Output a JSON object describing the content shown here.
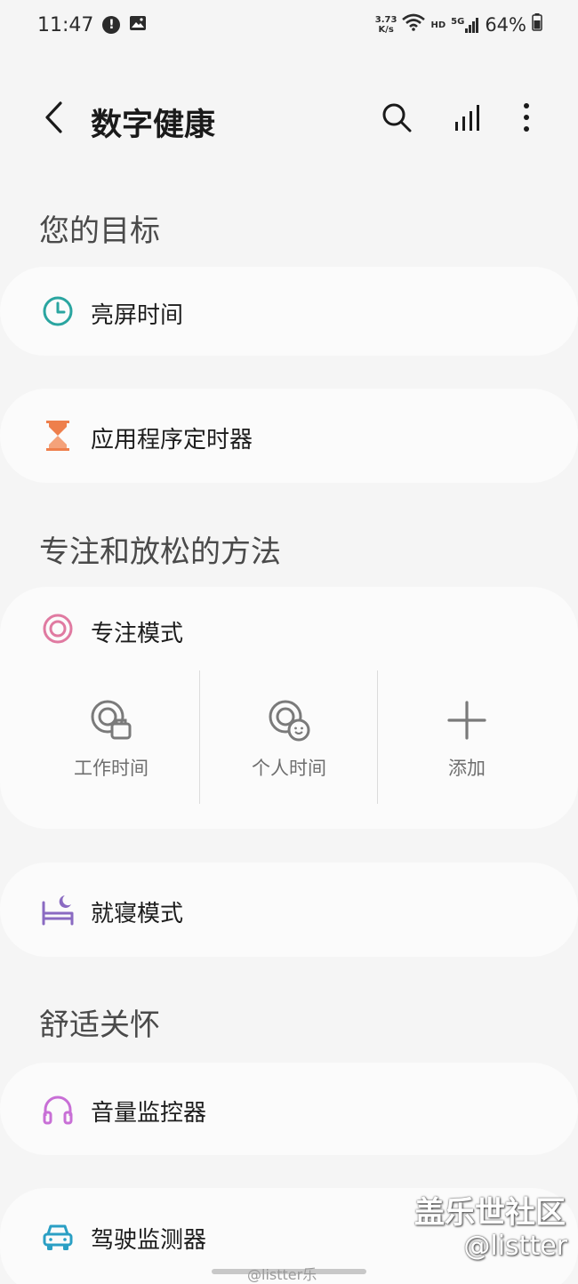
{
  "status_bar": {
    "time": "11:47",
    "net_speed_value": "3.73",
    "net_speed_unit": "K/s",
    "hd_label": "HD",
    "network_label": "5G",
    "battery_percent": "64%"
  },
  "header": {
    "title": "数字健康"
  },
  "sections": {
    "goals_title": "您的目标",
    "focus_title": "专注和放松的方法",
    "care_title": "舒适关怀"
  },
  "goals": {
    "screen_time": "亮屏时间",
    "app_timer": "应用程序定时器"
  },
  "focus": {
    "focus_mode": "专注模式",
    "modes": [
      {
        "label": "工作时间"
      },
      {
        "label": "个人时间"
      },
      {
        "label": "添加"
      }
    ],
    "bedtime_mode": "就寝模式"
  },
  "care": {
    "volume_monitor": "音量监控器",
    "driving_monitor": "驾驶监测器"
  },
  "watermark": {
    "community": "盖乐世社区",
    "handle": "@listter",
    "weibo": "@listter乐"
  },
  "colors": {
    "screen_time_icon": "#2aa5a0",
    "app_timer_icon": "#ee7f4c",
    "focus_icon": "#e07aa1",
    "bedtime_icon": "#8a6ac2",
    "volume_icon": "#c86fd6",
    "driving_icon": "#2a9fc4",
    "background": "#f5f5f5",
    "card": "#fbfbfb"
  },
  "icons": {
    "back": "chevron-left-icon",
    "search": "search-icon",
    "stats": "bar-chart-icon",
    "more": "more-vertical-icon"
  }
}
